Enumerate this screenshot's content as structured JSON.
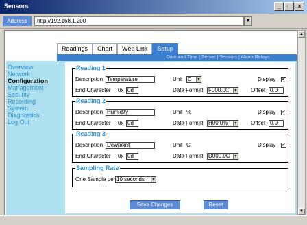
{
  "window": {
    "title": "Sensors"
  },
  "address_bar": {
    "label": "Address",
    "url": "http://192.168.1.200"
  },
  "tabs": [
    {
      "label": "Readings",
      "active": false
    },
    {
      "label": "Chart",
      "active": false
    },
    {
      "label": "Web Link",
      "active": false
    },
    {
      "label": "Setup",
      "active": true
    }
  ],
  "sub_nav": "Date and Time | Server | Sensors | Alarm Relays",
  "sidebar": {
    "items": [
      {
        "label": "Overview",
        "active": false
      },
      {
        "label": "Network",
        "active": false
      },
      {
        "label": "Configuration",
        "active": true
      },
      {
        "label": "Management",
        "active": false
      },
      {
        "label": "Security",
        "active": false
      },
      {
        "label": "Recording",
        "active": false
      },
      {
        "label": "System",
        "active": false
      },
      {
        "label": "Diagnostics",
        "active": false
      },
      {
        "label": "Log Out",
        "active": false
      }
    ]
  },
  "readings": [
    {
      "legend": "Reading 1",
      "description_label": "Description",
      "description": "Temperature",
      "unit_label": "Unit",
      "unit": "C",
      "unit_is_select": true,
      "display_label": "Display",
      "display_checked": true,
      "end_char_label": "End Character",
      "end_char_prefix": "0x",
      "end_char": "0d",
      "data_format_label": "Data Format",
      "data_format": "F000.0C",
      "has_offset": true,
      "offset_label": "Offset",
      "offset": "0.0"
    },
    {
      "legend": "Reading 2",
      "description_label": "Description",
      "description": "Humidity",
      "unit_label": "Unit",
      "unit": "%",
      "unit_is_select": false,
      "display_label": "Display",
      "display_checked": true,
      "end_char_label": "End Character",
      "end_char_prefix": "0x",
      "end_char": "0d",
      "data_format_label": "Data Format",
      "data_format": "H00.0%",
      "has_offset": true,
      "offset_label": "Offset",
      "offset": "0.0"
    },
    {
      "legend": "Reading 3",
      "description_label": "Description",
      "description": "Dewpoint",
      "unit_label": "Unit",
      "unit": "C",
      "unit_is_select": false,
      "display_label": "Display",
      "display_checked": true,
      "end_char_label": "End Character",
      "end_char_prefix": "0x",
      "end_char": "0d",
      "data_format_label": "Data Format",
      "data_format": "D000.0C",
      "has_offset": false
    }
  ],
  "sampling": {
    "legend": "Sampling Rate",
    "label": "One Sample per",
    "value": "10 seconds"
  },
  "buttons": {
    "save": "Save Changes",
    "reset": "Reset"
  },
  "colors": {
    "accent": "#3a7fd0",
    "sidebar_bg": "#aee0f0",
    "link": "#2e8fd0"
  }
}
